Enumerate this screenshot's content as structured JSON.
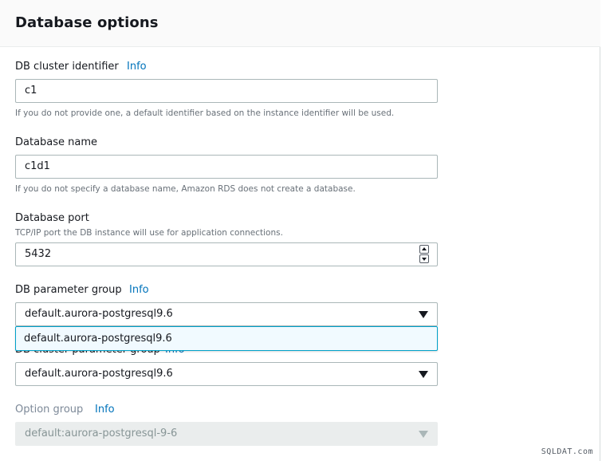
{
  "section": {
    "title": "Database options"
  },
  "cluster_identifier": {
    "label": "DB cluster identifier",
    "info": "Info",
    "value": "c1",
    "hint": "If you do not provide one, a default identifier based on the instance identifier will be used."
  },
  "database_name": {
    "label": "Database name",
    "value": "c1d1",
    "hint": "If you do not specify a database name, Amazon RDS does not create a database."
  },
  "database_port": {
    "label": "Database port",
    "hint": "TCP/IP port the DB instance will use for application connections.",
    "value": "5432"
  },
  "db_parameter_group": {
    "label": "DB parameter group",
    "info": "Info",
    "selected": "default.aurora-postgresql9.6",
    "options": [
      "default.aurora-postgresql9.6"
    ]
  },
  "db_cluster_parameter_group": {
    "label": "DB cluster parameter group",
    "info": "Info",
    "selected": "default.aurora-postgresql9.6"
  },
  "option_group": {
    "label": "Option group",
    "info": "Info",
    "selected": "default:aurora-postgresql-9-6",
    "disabled": true
  },
  "watermark": "SQLDAT.com",
  "colors": {
    "link": "#0073bb",
    "focus_border": "#00a1c9",
    "dropdown_highlight": "#f1faff",
    "disabled_bg": "#eaeded"
  }
}
